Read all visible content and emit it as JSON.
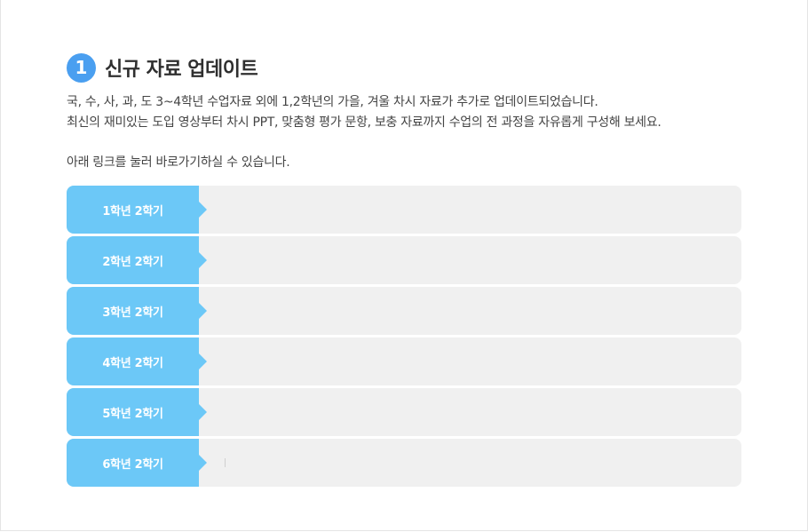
{
  "section": {
    "number": "1",
    "title": "신규 자료 업데이트"
  },
  "description": {
    "line1": "국, 수, 사, 과, 도 3~4학년 수업자료 외에 1,2학년의 가을, 겨울 차시 자료가 추가로 업데이트되었습니다.",
    "line2": "최신의 재미있는 도입 영상부터 차시 PPT, 맞춤형 평가 문항, 보충 자료까지 수업의 전 과정을 자유롭게 구성해 보세요."
  },
  "hint": "아래 링크를 눌러 바로가기하실 수 있습니다.",
  "grades": [
    {
      "label": "1학년 2학기"
    },
    {
      "label": "2학년 2학기"
    },
    {
      "label": "3학년 2학기"
    },
    {
      "label": "4학년 2학기"
    },
    {
      "label": "5학년 2학기"
    },
    {
      "label": "6학년 2학기"
    }
  ],
  "colors": {
    "badge": "#4a9ff0",
    "tab": "#6cc8f7",
    "row_background": "#f0f0f0"
  }
}
